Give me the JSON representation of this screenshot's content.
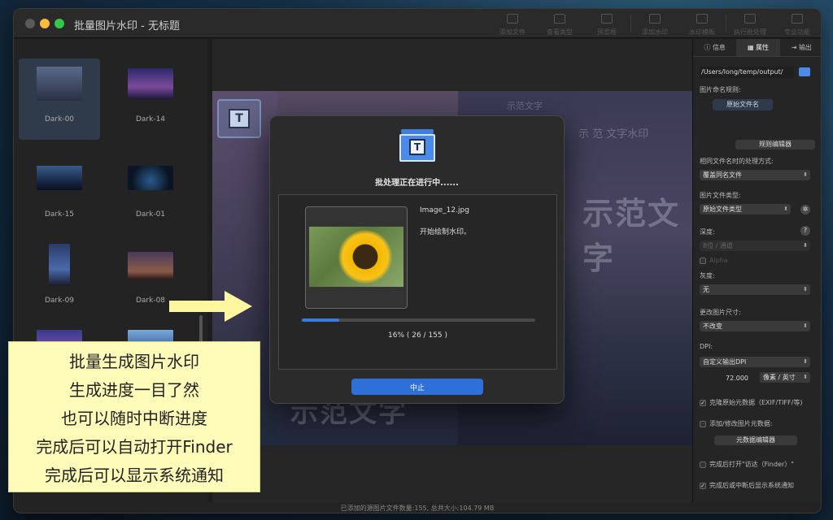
{
  "window": {
    "title": "批量图片水印 - 无标题"
  },
  "toolbar": {
    "buttons": [
      {
        "label": "添加文件"
      },
      {
        "label": "查看类型"
      },
      {
        "label": "预览框"
      },
      {
        "label": "添加水印"
      },
      {
        "label": "水印模板"
      },
      {
        "label": "执行批处理"
      },
      {
        "label": "专业功能"
      }
    ]
  },
  "sidebar": {
    "thumbnails": [
      {
        "label": "Dark-00",
        "selected": true
      },
      {
        "label": "Dark-14",
        "selected": false
      },
      {
        "label": "Dark-15",
        "selected": false
      },
      {
        "label": "Dark-01",
        "selected": false
      },
      {
        "label": "Dark-09",
        "selected": false
      },
      {
        "label": "Dark-08",
        "selected": false
      }
    ]
  },
  "preview": {
    "watermark_text_1": "示范文字",
    "watermark_text_2": "示 范 文字水印",
    "watermark_text_big": "示范文字",
    "watermark_text_bottom": "示范文字",
    "watermark_logo_letter": "T"
  },
  "dialog": {
    "icon_letter": "T",
    "title": "批处理正在进行中......",
    "filename": "Image_12.jpg",
    "status": "开始绘制水印。",
    "progress_fraction": 0.16,
    "progress_text": "16%  ( 26 / 155 )",
    "stop_label": "中止"
  },
  "right_panel": {
    "tabs": [
      {
        "label": "信息",
        "active": false
      },
      {
        "label": "属性",
        "active": true
      },
      {
        "label": "输出",
        "active": false
      }
    ],
    "output_path": "/Users/long/temp/output/",
    "naming_rule_label": "图片命名规则:",
    "naming_rule_tag": "原始文件名",
    "rule_editor_button": "规则编辑器",
    "same_name_label": "相同文件名时的处理方式:",
    "same_name_value": "覆盖同名文件",
    "file_type_label": "图片文件类型:",
    "file_type_value": "原始文件类型",
    "depth_label": "深度:",
    "depth_value": "8位 / 通道",
    "alpha_label": "Alpha",
    "gray_label": "灰度:",
    "gray_value": "无",
    "resize_label": "更改图片尺寸:",
    "resize_value": "不改变",
    "dpi_label": "DPI:",
    "dpi_value": "自定义输出DPI",
    "dpi_number": "72.000",
    "dpi_unit": "像素 / 英寸",
    "clone_meta_label": "克隆原始元数据（EXIF/TIFF/等)",
    "clone_meta_checked": true,
    "edit_meta_label": "添加/修改图片元数据:",
    "edit_meta_checked": false,
    "meta_editor_button": "元数据编辑器",
    "open_finder_label": "完成后打开\"访达（Finder）\"",
    "open_finder_checked": false,
    "notify_label": "完成后或中断后显示系统通知",
    "notify_checked": true
  },
  "statusbar": {
    "text": "已添加的源图片文件数量:155, 总共大小:104.79 MB"
  },
  "callout": {
    "lines": [
      "批量生成图片水印",
      "生成进度一目了然",
      "也可以随时中断进度",
      "完成后可以自动打开Finder",
      "完成后可以显示系统通知"
    ]
  }
}
